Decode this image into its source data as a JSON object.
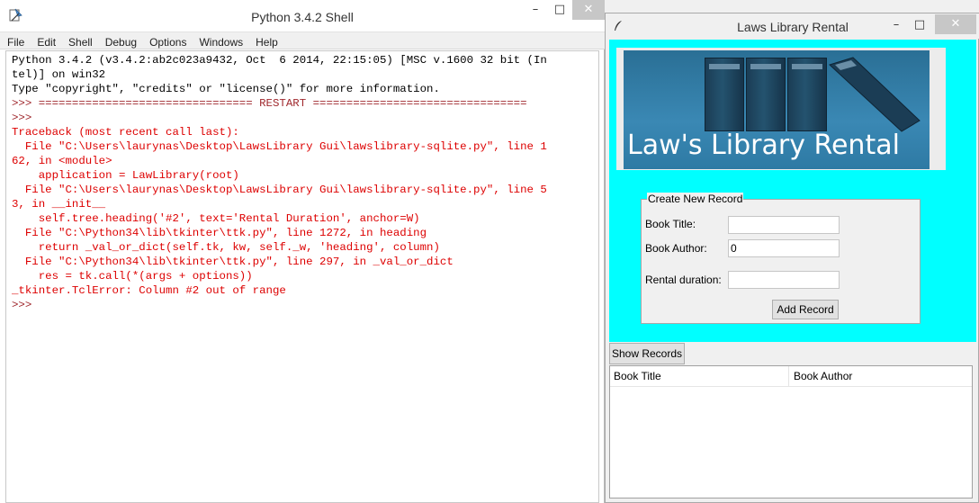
{
  "shell": {
    "title": "Python 3.4.2 Shell",
    "menu": [
      "File",
      "Edit",
      "Shell",
      "Debug",
      "Options",
      "Windows",
      "Help"
    ],
    "controls": {
      "minimize": "–",
      "maximize": "□",
      "close": "✕"
    },
    "lines": [
      {
        "text": "Python 3.4.2 (v3.4.2:ab2c023a9432, Oct  6 2014, 22:15:05) [MSC v.1600 32 bit (In",
        "color": "black"
      },
      {
        "text": "tel)] on win32",
        "color": "black"
      },
      {
        "text": "Type \"copyright\", \"credits\" or \"license()\" for more information.",
        "color": "black"
      },
      {
        "text": ">>> ================================ RESTART ================================",
        "color": "brown"
      },
      {
        "text": ">>> ",
        "color": "brown"
      },
      {
        "text": "Traceback (most recent call last):",
        "color": "red"
      },
      {
        "text": "  File \"C:\\Users\\laurynas\\Desktop\\LawsLibrary Gui\\lawslibrary-sqlite.py\", line 1",
        "color": "red"
      },
      {
        "text": "62, in <module>",
        "color": "red"
      },
      {
        "text": "    application = LawLibrary(root)",
        "color": "red"
      },
      {
        "text": "  File \"C:\\Users\\laurynas\\Desktop\\LawsLibrary Gui\\lawslibrary-sqlite.py\", line 5",
        "color": "red"
      },
      {
        "text": "3, in __init__",
        "color": "red"
      },
      {
        "text": "    self.tree.heading('#2', text='Rental Duration', anchor=W)",
        "color": "red"
      },
      {
        "text": "  File \"C:\\Python34\\lib\\tkinter\\ttk.py\", line 1272, in heading",
        "color": "red"
      },
      {
        "text": "    return _val_or_dict(self.tk, kw, self._w, 'heading', column)",
        "color": "red"
      },
      {
        "text": "  File \"C:\\Python34\\lib\\tkinter\\ttk.py\", line 297, in _val_or_dict",
        "color": "red"
      },
      {
        "text": "    res = tk.call(*(args + options))",
        "color": "red"
      },
      {
        "text": "_tkinter.TclError: Column #2 out of range",
        "color": "red"
      },
      {
        "text": ">>> ",
        "color": "brown"
      }
    ]
  },
  "app": {
    "title": "Laws Library Rental",
    "controls": {
      "minimize": "–",
      "maximize": "□",
      "close": "✕"
    },
    "banner_text": "Law's Library Rental",
    "form": {
      "legend": "Create New Record",
      "book_title_label": "Book Title:",
      "book_title_value": "",
      "book_author_label": "Book Author:",
      "book_author_value": "0",
      "rental_duration_label": "Rental duration:",
      "rental_duration_value": "",
      "add_button": "Add Record"
    },
    "show_records_button": "Show Records",
    "tree_columns": [
      "Book Title",
      "Book Author"
    ],
    "colors": {
      "background": "#00ffff"
    }
  }
}
